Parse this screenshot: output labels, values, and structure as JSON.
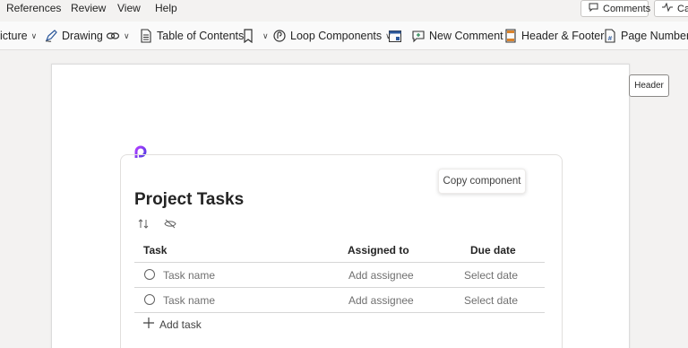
{
  "menubar": {
    "items": [
      "References",
      "Review",
      "View",
      "Help"
    ],
    "comments_label": "Comments",
    "catchup_label": "Cat"
  },
  "ribbon": {
    "picture_label": "icture",
    "drawing_label": "Drawing",
    "toc_label": "Table of Contents",
    "loop_label": "Loop Components",
    "new_comment_label": "New Comment",
    "header_footer_label": "Header & Footer",
    "page_numbers_label": "Page Numbers"
  },
  "document": {
    "header_tag": "Header",
    "loop": {
      "copy_button": "Copy component",
      "title": "Project Tasks",
      "columns": [
        "Task",
        "Assigned to",
        "Due date"
      ],
      "rows": [
        {
          "task": "Task name",
          "assignee": "Add assignee",
          "due": "Select date"
        },
        {
          "task": "Task name",
          "assignee": "Add assignee",
          "due": "Select date"
        }
      ],
      "add_task_label": "Add task"
    }
  },
  "colors": {
    "loop_accent": "#7b2cf2",
    "background": "#f3f2f1"
  }
}
